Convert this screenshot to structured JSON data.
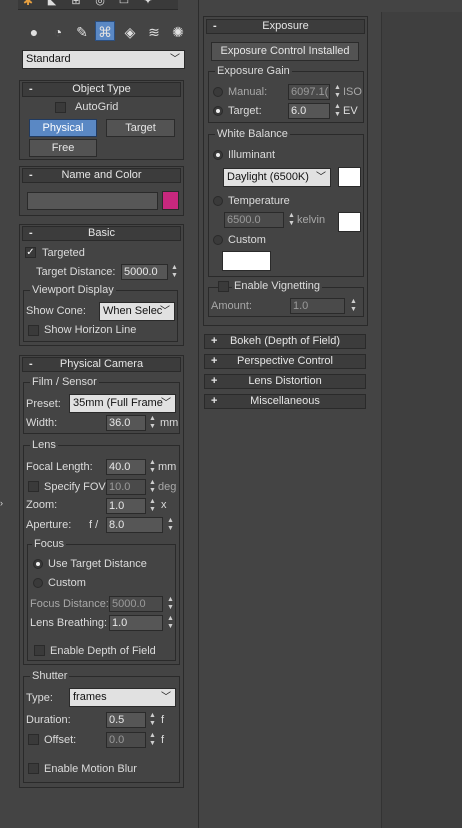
{
  "toolbar": {
    "icons": [
      "geometry-sphere-icon",
      "shapes-icon",
      "lights-icon",
      "cameras-icon",
      "helpers-icon",
      "spacewarps-icon",
      "systems-icon"
    ],
    "category_dropdown": "Standard"
  },
  "object_type": {
    "title": "Object Type",
    "autogrid_label": "AutoGrid",
    "buttons": [
      "Physical",
      "Target",
      "Free"
    ]
  },
  "name_color": {
    "title": "Name and Color",
    "name_value": "",
    "color": "#c8287e"
  },
  "basic": {
    "title": "Basic",
    "targeted_label": "Targeted",
    "target_distance_label": "Target Distance:",
    "target_distance_value": "5000.0",
    "viewport_display_label": "Viewport Display",
    "show_cone_label": "Show Cone:",
    "show_cone_value": "When Selec",
    "show_horizon_label": "Show Horizon Line"
  },
  "physical_camera": {
    "title": "Physical Camera",
    "film_sensor_label": "Film / Sensor",
    "preset_label": "Preset:",
    "preset_value": "35mm (Full Frame",
    "width_label": "Width:",
    "width_value": "36.0",
    "width_unit": "mm",
    "lens_label": "Lens",
    "focal_length_label": "Focal Length:",
    "focal_length_value": "40.0",
    "focal_length_unit": "mm",
    "specify_fov_label": "Specify FOV:",
    "fov_value": "10.0",
    "fov_unit": "deg",
    "zoom_label": "Zoom:",
    "zoom_value": "1.0",
    "zoom_unit": "x",
    "aperture_label": "Aperture:",
    "aperture_prefix": "f /",
    "aperture_value": "8.0",
    "focus_label": "Focus",
    "use_target_distance_label": "Use Target Distance",
    "custom_label": "Custom",
    "focus_distance_label": "Focus Distance:",
    "focus_distance_value": "5000.0",
    "lens_breathing_label": "Lens Breathing:",
    "lens_breathing_value": "1.0",
    "enable_dof_label": "Enable Depth of Field",
    "shutter_label": "Shutter",
    "type_label": "Type:",
    "type_value": "frames",
    "duration_label": "Duration:",
    "duration_value": "0.5",
    "duration_unit": "f",
    "offset_label": "Offset:",
    "offset_value": "0.0",
    "offset_unit": "f",
    "enable_motion_blur_label": "Enable Motion Blur"
  },
  "exposure": {
    "title": "Exposure",
    "control_installed_label": "Exposure Control Installed",
    "exposure_gain_label": "Exposure Gain",
    "manual_label": "Manual:",
    "manual_value": "6097.1(",
    "manual_unit": "ISO",
    "target_label": "Target:",
    "target_value": "6.0",
    "target_unit": "EV",
    "white_balance_label": "White Balance",
    "illuminant_label": "Illuminant",
    "illuminant_value": "Daylight (6500K)",
    "temperature_label": "Temperature",
    "temperature_value": "6500.0",
    "temperature_unit": "kelvin",
    "custom_label": "Custom",
    "enable_vignetting_label": "Enable Vignetting",
    "amount_label": "Amount:",
    "amount_value": "1.0"
  },
  "collapsed_rollouts": [
    "Bokeh (Depth of Field)",
    "Perspective Control",
    "Lens Distortion",
    "Miscellaneous"
  ]
}
